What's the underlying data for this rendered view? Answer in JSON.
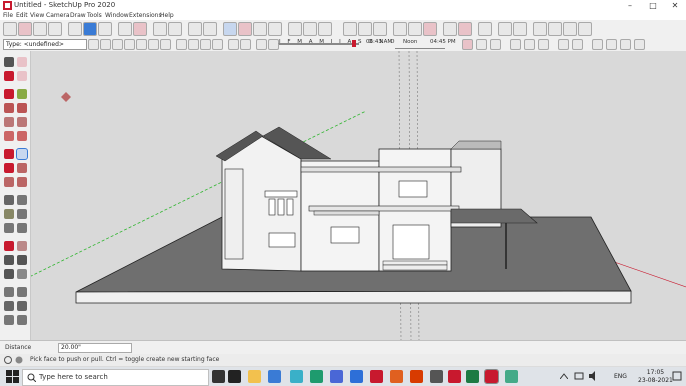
{
  "window": {
    "title": "Untitled - SketchUp Pro 2020",
    "minimize_glyph": "–",
    "maximize_glyph": "□",
    "close_glyph": "✕"
  },
  "menu": {
    "items": [
      "File",
      "Edit",
      "View",
      "Camera",
      "Draw",
      "Tools",
      "Window",
      "Extensions",
      "Help"
    ]
  },
  "toolbar": {
    "type_selector_value": "Type: <undefined>",
    "months": "J F M A M J J A S O N D",
    "time_start": "06:43 AM",
    "time_noon": "Noon",
    "time_end": "04:45 PM"
  },
  "measurements": {
    "label": "Distance",
    "value": "20.00\""
  },
  "status": {
    "hint": "Pick face to push or pull.  Ctrl = toggle create new starting face"
  },
  "taskbar": {
    "search_placeholder": "Type here to search",
    "language": "ENG",
    "time": "17:05",
    "date": "23-08-2021"
  },
  "colors": {
    "accent_red": "#c8192e",
    "axis_green": "#2fb52f",
    "axis_blue": "#3a7bd5",
    "viewport_bg": "#d9d9d9"
  }
}
